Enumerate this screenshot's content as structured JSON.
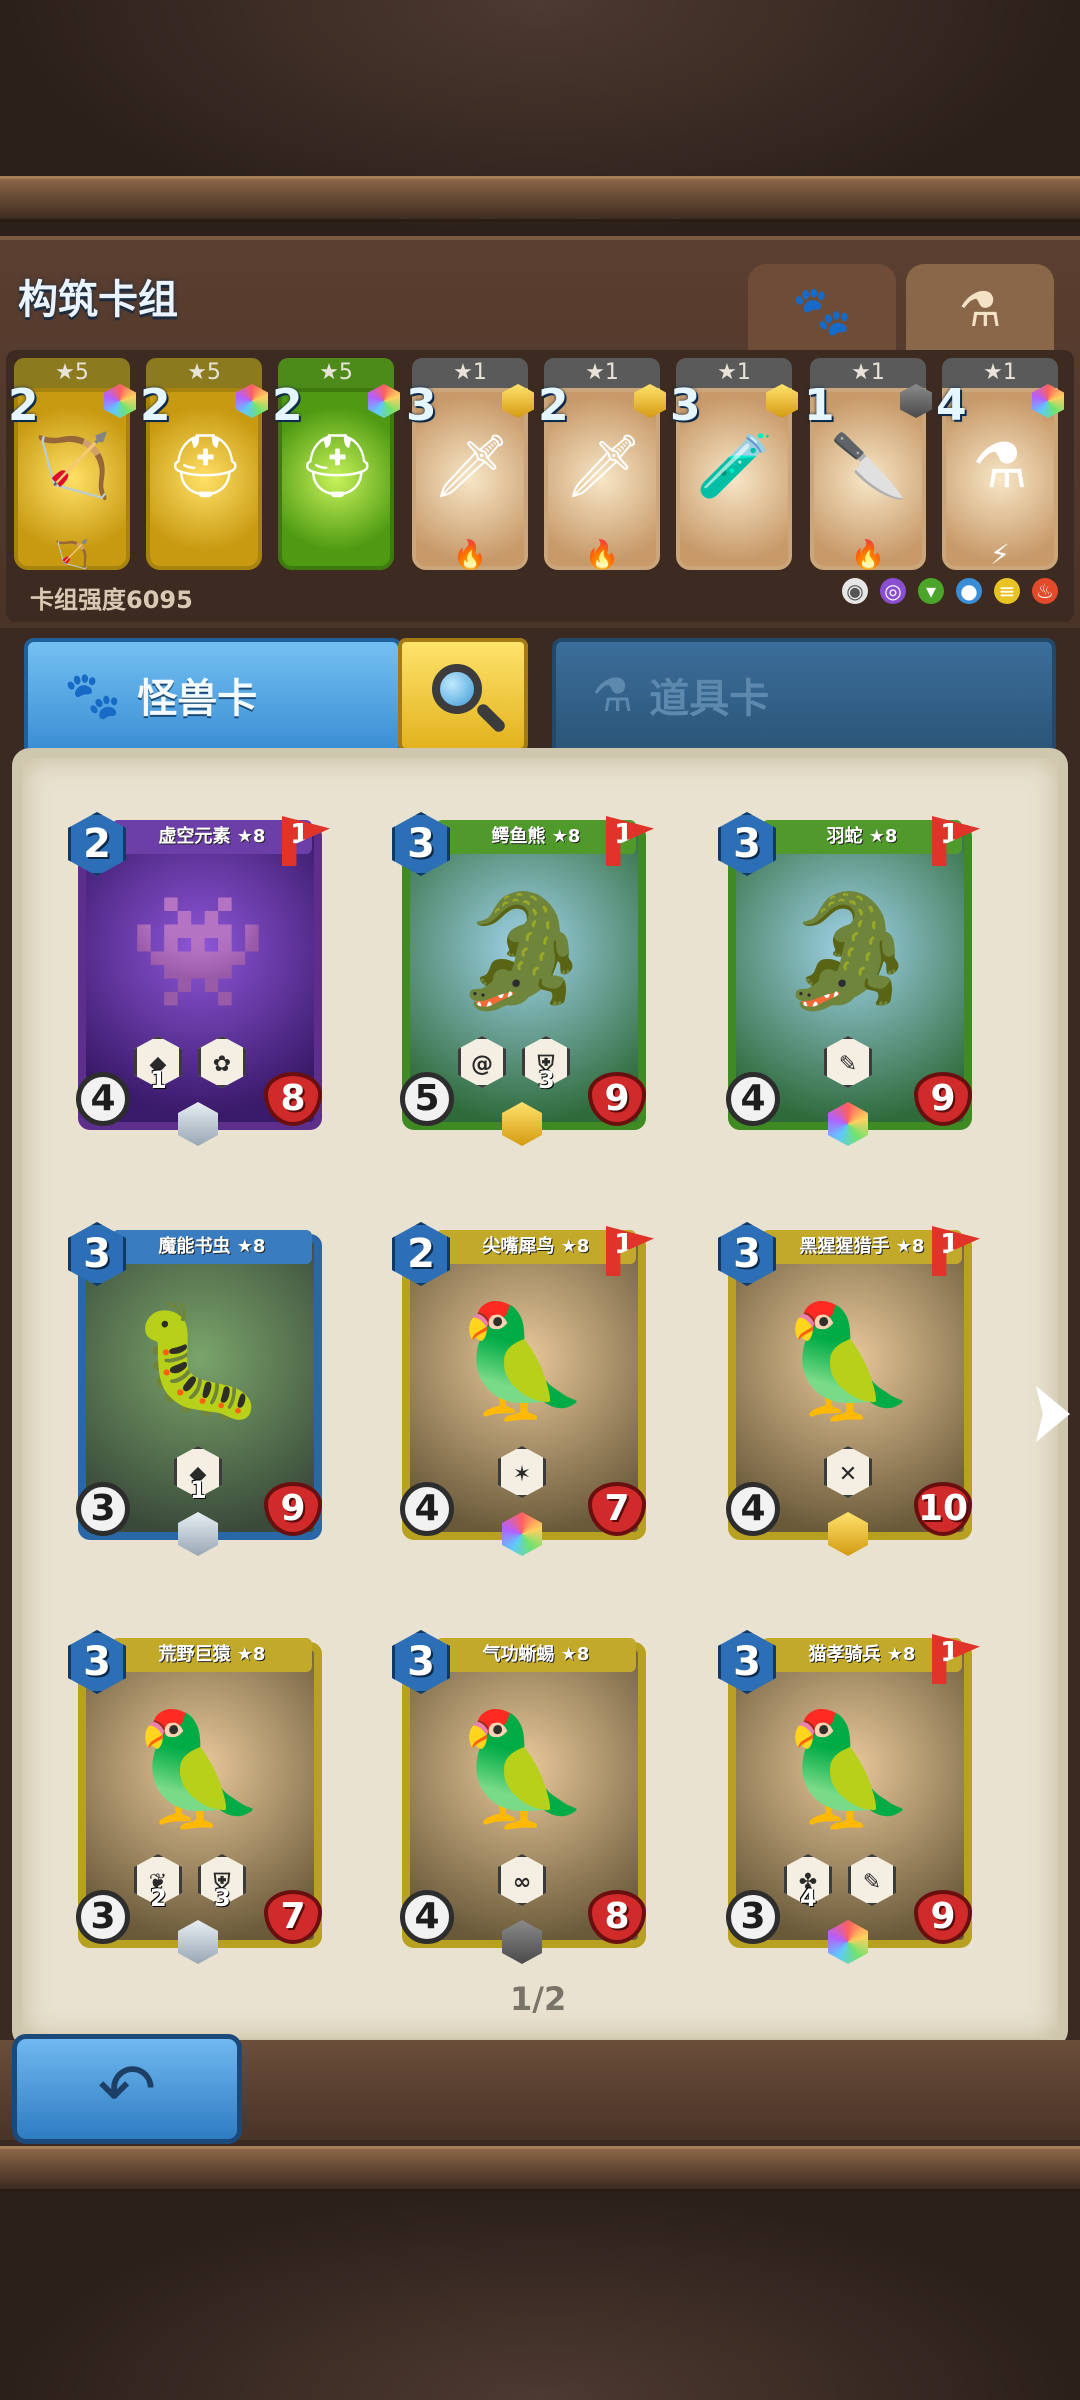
{
  "header": {
    "title": "构筑卡组",
    "tabs": [
      {
        "icon": "paw-icon",
        "active": false
      },
      {
        "icon": "potion-icon",
        "active": true
      }
    ]
  },
  "deck": {
    "cards": [
      {
        "stars": "★5",
        "cost": "2",
        "style": "gold",
        "art": "crossbow-icon",
        "footer": "bow-icon"
      },
      {
        "stars": "★5",
        "cost": "2",
        "style": "gold",
        "art": "helmet-icon",
        "footer": ""
      },
      {
        "stars": "★5",
        "cost": "2",
        "style": "green",
        "art": "helmet-icon",
        "footer": ""
      },
      {
        "stars": "★1",
        "cost": "3",
        "style": "item",
        "art": "sword-icon",
        "footer": "fire-icon"
      },
      {
        "stars": "★1",
        "cost": "2",
        "style": "item",
        "art": "sword-icon",
        "footer": "fire-icon"
      },
      {
        "stars": "★1",
        "cost": "3",
        "style": "item",
        "art": "vial-icon",
        "footer": ""
      },
      {
        "stars": "★1",
        "cost": "1",
        "style": "item",
        "art": "dagger-icon",
        "footer": "fire-icon"
      },
      {
        "stars": "★1",
        "cost": "4",
        "style": "item",
        "art": "potion-icon",
        "footer": "lightning-icon"
      }
    ],
    "power_label": "卡组强度6095",
    "elements": [
      "neutral-icon",
      "void-icon",
      "nature-icon",
      "water-icon",
      "wind-icon",
      "fire-icon"
    ]
  },
  "categories": {
    "monster": "怪兽卡",
    "item": "道具卡"
  },
  "monster_cards": [
    {
      "name": "虚空元素 ★8",
      "cost": "2",
      "flag": "1",
      "attack": "4",
      "hp": "8",
      "color": "purple",
      "rarity": "silver",
      "skills": [
        {
          "icon": "crystal",
          "num": "1"
        },
        {
          "icon": "shell",
          "num": ""
        }
      ]
    },
    {
      "name": "鳄鱼熊 ★8",
      "cost": "3",
      "flag": "1",
      "attack": "5",
      "hp": "9",
      "color": "green",
      "rarity": "gold",
      "skills": [
        {
          "icon": "swirl",
          "num": ""
        },
        {
          "icon": "armor",
          "num": "3"
        }
      ]
    },
    {
      "name": "羽蛇 ★8",
      "cost": "3",
      "flag": "1",
      "attack": "4",
      "hp": "9",
      "color": "green",
      "rarity": "rainbow",
      "skills": [
        {
          "icon": "feather",
          "num": ""
        }
      ]
    },
    {
      "name": "魔能书虫 ★8",
      "cost": "3",
      "flag": "",
      "attack": "3",
      "hp": "9",
      "color": "blue",
      "rarity": "silver",
      "skills": [
        {
          "icon": "crystal",
          "num": "1"
        }
      ]
    },
    {
      "name": "尖嘴犀鸟 ★8",
      "cost": "2",
      "flag": "1",
      "attack": "4",
      "hp": "7",
      "color": "yellow",
      "rarity": "rainbow",
      "skills": [
        {
          "icon": "claw",
          "num": ""
        }
      ]
    },
    {
      "name": "黑猩猩猎手 ★8",
      "cost": "3",
      "flag": "1",
      "attack": "4",
      "hp": "10",
      "color": "yellow",
      "rarity": "gold",
      "skills": [
        {
          "icon": "cross",
          "num": ""
        }
      ]
    },
    {
      "name": "荒野巨猿 ★8",
      "cost": "3",
      "flag": "",
      "attack": "3",
      "hp": "7",
      "color": "yellow",
      "rarity": "silver",
      "skills": [
        {
          "icon": "leaf",
          "num": "2"
        },
        {
          "icon": "shield",
          "num": "3"
        }
      ]
    },
    {
      "name": "气功蜥蜴 ★8",
      "cost": "3",
      "flag": "",
      "attack": "4",
      "hp": "8",
      "color": "yellow",
      "rarity": "dark",
      "skills": [
        {
          "icon": "coil",
          "num": ""
        }
      ]
    },
    {
      "name": "猫孝骑兵 ★8",
      "cost": "3",
      "flag": "1",
      "attack": "3",
      "hp": "9",
      "color": "yellow",
      "rarity": "rainbow",
      "skills": [
        {
          "icon": "paw",
          "num": "4"
        },
        {
          "icon": "feather",
          "num": ""
        }
      ]
    }
  ],
  "pagination": "1/2",
  "colors": {
    "accent_blue": "#3b8fd4",
    "search_yellow": "#e2b21e",
    "hp_red": "#d02a2a",
    "paper": "#e9e2d0"
  }
}
